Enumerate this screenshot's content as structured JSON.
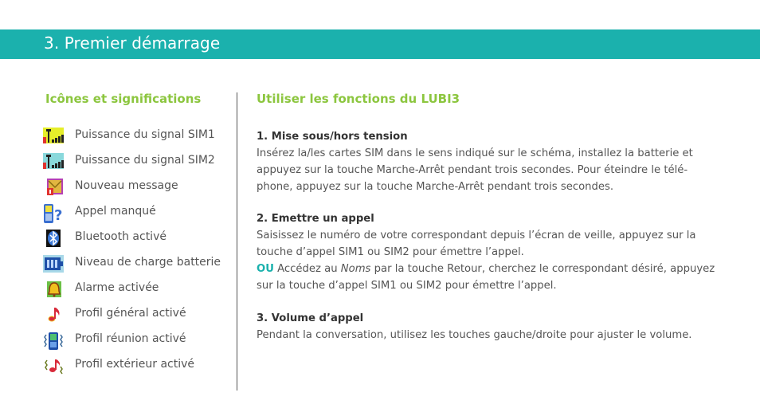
{
  "header": {
    "title": "3. Premier démarrage"
  },
  "icons_section": {
    "title": "Icônes et significations",
    "items": [
      {
        "icon": "signal-sim1-icon",
        "label": "Puissance du signal SIM1"
      },
      {
        "icon": "signal-sim2-icon",
        "label": "Puissance du signal SIM2"
      },
      {
        "icon": "new-message-icon",
        "label": "Nouveau message"
      },
      {
        "icon": "missed-call-icon",
        "label": "Appel manqué"
      },
      {
        "icon": "bluetooth-icon",
        "label": "Bluetooth activé"
      },
      {
        "icon": "battery-icon",
        "label": "Niveau de charge batterie"
      },
      {
        "icon": "alarm-bell-icon",
        "label": "Alarme activée"
      },
      {
        "icon": "music-note-icon",
        "label": "Profil général activé"
      },
      {
        "icon": "vibrate-phone-icon",
        "label": "Profil réunion activé"
      },
      {
        "icon": "outdoor-profile-icon",
        "label": "Profil extérieur activé"
      }
    ]
  },
  "functions_section": {
    "title": "Utiliser les fonctions du LUBI3",
    "sections": [
      {
        "heading": "1. Mise sous/hors tension",
        "lines": [
          "Insérez la/les cartes SIM dans le sens indiqué sur le schéma, installez la batterie et",
          "appuyez sur la touche Marche-Arrêt pendant trois secondes. Pour éteindre le télé-",
          "phone, appuyez sur la touche Marche-Arrêt pendant trois secondes."
        ]
      },
      {
        "heading": "2. Emettre un appel",
        "lines": [
          "Saisissez le numéro de votre correspondant depuis l’écran de veille, appuyez sur la",
          "touche d’appel SIM1 ou SIM2 pour émettre l’appel."
        ],
        "alt_keyword": "OU",
        "alt_pre": "Accédez au",
        "alt_italic": "Noms",
        "alt_post": "par la touche Retour, cherchez le correspondant désiré, appuyez",
        "alt_line2": "sur la touche d’appel SIM1 ou SIM2 pour émettre l’appel."
      },
      {
        "heading": "3. Volume d’appel",
        "lines": [
          "Pendant la conversation, utilisez les touches gauche/droite pour ajuster le volume."
        ]
      }
    ]
  },
  "colors": {
    "accent_teal": "#1bb1ad",
    "accent_green": "#8cc63f"
  }
}
